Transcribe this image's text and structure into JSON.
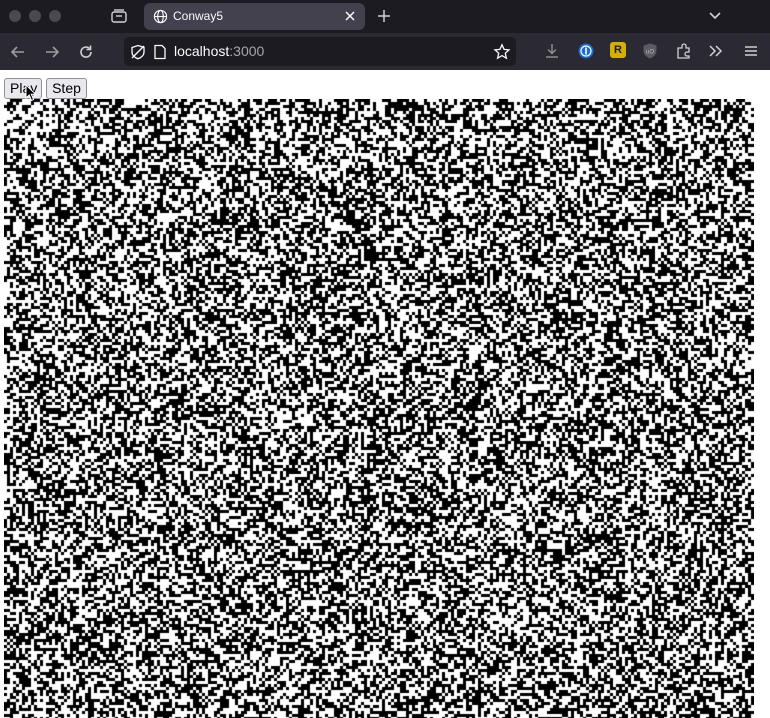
{
  "window": {
    "tab_title": "Conway5",
    "url_host": "localhost",
    "url_port": ":3000"
  },
  "page": {
    "play_label": "Play",
    "step_label": "Step"
  },
  "board": {
    "alive_color": "#000000",
    "dead_color": "#ffffff",
    "seed": 1337,
    "density": 0.5
  },
  "colors": {
    "chrome_dark": "#1c1b22",
    "toolbar": "#2b2a33",
    "tab_active": "#42414d"
  }
}
